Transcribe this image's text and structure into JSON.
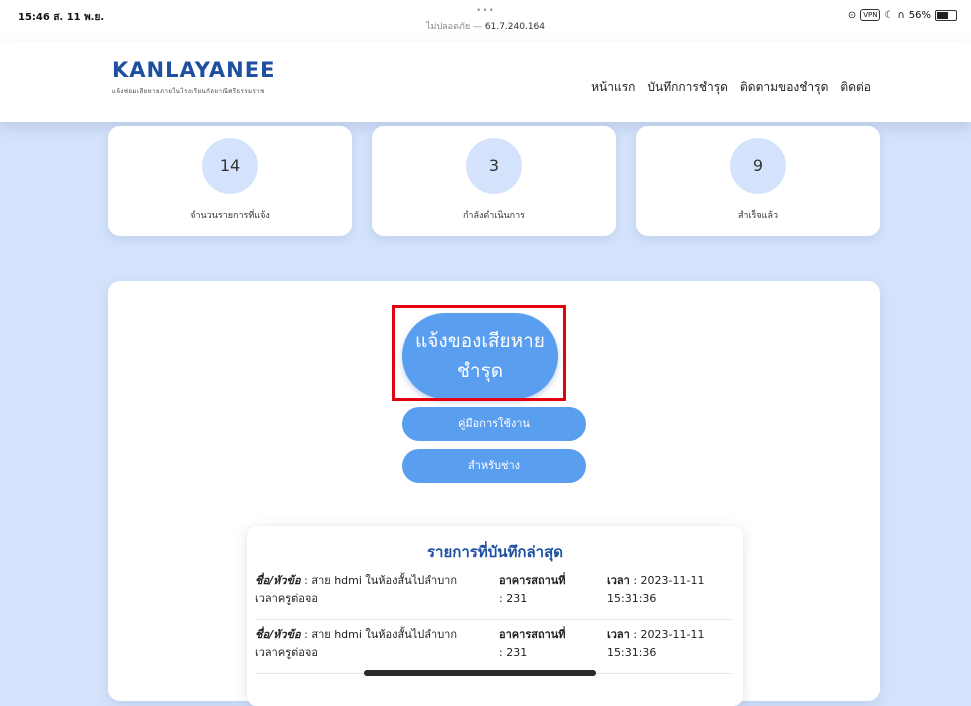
{
  "status_bar": {
    "time": "15:46  ส. 11 พ.ย.",
    "dots": "•••",
    "insecure_label": "ไม่ปลอดภัย —",
    "url": "61.7.240.164",
    "vpn": "VPN",
    "battery": "56%",
    "battery_level": 0.56
  },
  "header": {
    "brand_title": "KANLAYANEE",
    "brand_subtitle": "แจ้งซ่อมเสียหายภายในโรงเรียนกัลยาณีศรีธรรมราช",
    "menu": [
      "หน้าแรก",
      "บันทึกการชำรุด",
      "ติดตามของชำรุด",
      "ติดต่อ"
    ]
  },
  "stats": [
    {
      "value": "14",
      "label": "จำนวนรายการที่แจ้ง"
    },
    {
      "value": "3",
      "label": "กำลังดำเนินการ"
    },
    {
      "value": "9",
      "label": "สำเร็จแล้ว"
    }
  ],
  "actions": {
    "report_line1": "แจ้งของเสียหาย",
    "report_line2": "ชำรุด",
    "manual": "คู่มือการใช้งาน",
    "technician": "สำหรับช่าง"
  },
  "recent": {
    "title": "รายการที่บันทึกล่าสุด",
    "rows": [
      {
        "subject_label": "ชื่อ/หัวข้อ",
        "subject_text": " : สาย hdmi ในห้องสั้นไปลำบาก",
        "subject_text2": "เวลาครูต่อจอ",
        "building_label": "อาคารสถานที่",
        "building_value": ": 231",
        "time_label": "เวลา",
        "time_value": " : 2023-11-11",
        "time_value2": "15:31:36"
      },
      {
        "subject_label": "ชื่อ/หัวข้อ",
        "subject_text": " : สาย hdmi ในห้องสั้นไปลำบาก",
        "subject_text2": "เวลาครูต่อจอ",
        "building_label": "อาคารสถานที่",
        "building_value": ": 231",
        "time_label": "เวลา",
        "time_value": " : 2023-11-11",
        "time_value2": "15:31:36"
      }
    ]
  },
  "colors": {
    "background": "#d4e3fb",
    "brand": "#1e4fa1",
    "button": "#5a9ef0",
    "highlight": "#e3000f"
  }
}
